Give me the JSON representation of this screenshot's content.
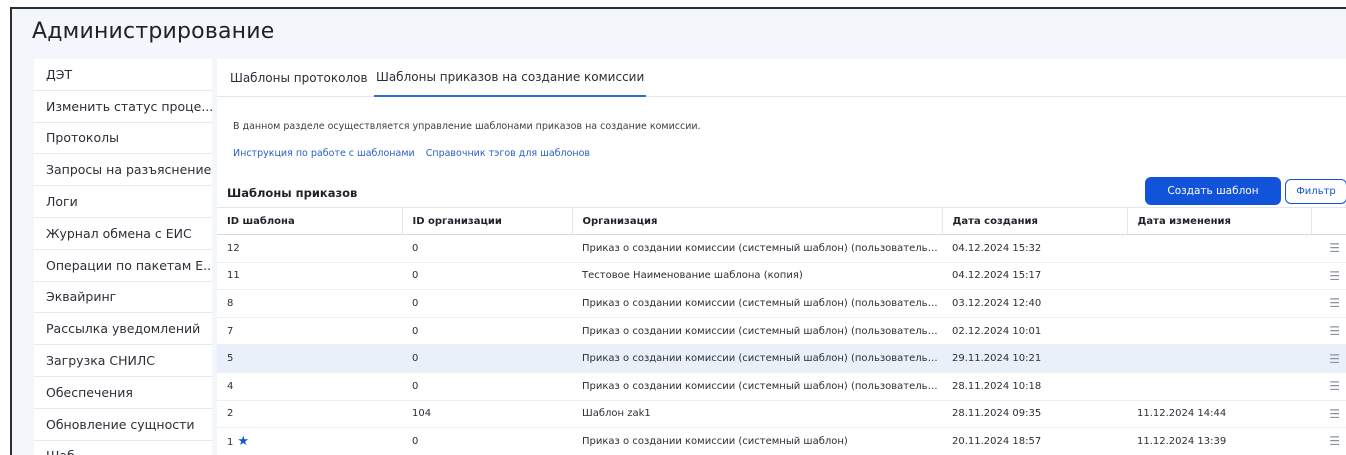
{
  "page": {
    "title": "Администрирование"
  },
  "sidebar": {
    "items": [
      {
        "label": "ДЭТ"
      },
      {
        "label": "Изменить статус проце..."
      },
      {
        "label": "Протоколы"
      },
      {
        "label": "Запросы на разъяснение"
      },
      {
        "label": "Логи"
      },
      {
        "label": "Журнал обмена с ЕИС"
      },
      {
        "label": "Операции по пакетам Е..."
      },
      {
        "label": "Эквайринг"
      },
      {
        "label": "Рассылка уведомлений"
      },
      {
        "label": "Загрузка СНИЛС"
      },
      {
        "label": "Обеспечения"
      },
      {
        "label": "Обновление сущности"
      },
      {
        "label": "Шаб..."
      }
    ]
  },
  "tabs": [
    {
      "label": "Шаблоны протоколов"
    },
    {
      "label": "Шаблоны приказов на создание комиссии"
    }
  ],
  "content": {
    "description": "В данном разделе осуществляется управление шаблонами приказов на создание комиссии.",
    "link_instruction": "Инструкция по работе с шаблонами",
    "link_tags": "Справочник тэгов для шаблонов",
    "section_title": "Шаблоны приказов",
    "create_button": "Создать шаблон",
    "filter_button": "Фильтр"
  },
  "table": {
    "headers": [
      "ID шаблона",
      "ID организации",
      "Организация",
      "Дата создания",
      "Дата изменения"
    ],
    "rows": [
      {
        "id": "12",
        "org_id": "0",
        "org": "Приказ о создании комиссии (системный шаблон) (пользовательский)",
        "created": "04.12.2024 15:32",
        "modified": ""
      },
      {
        "id": "11",
        "org_id": "0",
        "org": "Тестовое Наименование шаблона (копия)",
        "created": "04.12.2024 15:17",
        "modified": ""
      },
      {
        "id": "8",
        "org_id": "0",
        "org": "Приказ о создании комиссии (системный шаблон) (пользовательски...",
        "created": "03.12.2024 12:40",
        "modified": ""
      },
      {
        "id": "7",
        "org_id": "0",
        "org": "Приказ о создании комиссии (системный шаблон) (пользовательский)",
        "created": "02.12.2024 10:01",
        "modified": ""
      },
      {
        "id": "5",
        "org_id": "0",
        "org": "Приказ о создании комиссии (системный шаблон) (пользовательский)",
        "created": "29.11.2024 10:21",
        "modified": ""
      },
      {
        "id": "4",
        "org_id": "0",
        "org": "Приказ о создании комиссии (системный шаблон) (пользовательский)",
        "created": "28.11.2024 10:18",
        "modified": ""
      },
      {
        "id": "2",
        "org_id": "104",
        "org": "Шаблон zak1",
        "created": "28.11.2024 09:35",
        "modified": "11.12.2024 14:44"
      },
      {
        "id": "1",
        "org_id": "0",
        "org": "Приказ о создании комиссии (системный шаблон)",
        "created": "20.11.2024 18:57",
        "modified": "11.12.2024 13:39"
      }
    ]
  },
  "icons": {
    "row_menu": "list-menu-icon",
    "default_marker": "star-icon"
  },
  "colors": {
    "accent": "#1254d9",
    "selected_row": "#eaf0fa",
    "link": "#2a5fc9"
  }
}
